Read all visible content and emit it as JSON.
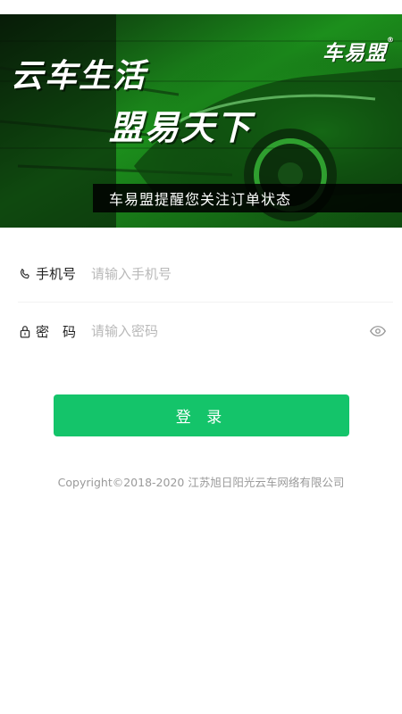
{
  "banner": {
    "slogan_line1": "云车生活",
    "slogan_line2": "盟易天下",
    "brand_logo": "车易盟",
    "brand_mark": "®",
    "caption": "车易盟提醒您关注订单状态"
  },
  "form": {
    "phone": {
      "icon": "phone-icon",
      "label": "手机号",
      "placeholder": "请输入手机号",
      "value": ""
    },
    "password": {
      "icon": "lock-icon",
      "label": "密　码",
      "placeholder": "请输入密码",
      "value": "",
      "toggle_icon": "eye-icon"
    }
  },
  "login_button": {
    "label": "登 录"
  },
  "footer": {
    "copyright": "Copyright©2018-2020 江苏旭日阳光云车网络有限公司"
  },
  "colors": {
    "accent": "#14c46a",
    "banner_green": "#1aa51a",
    "placeholder": "#b9b9b9",
    "footer_text": "#9a9a9a"
  }
}
